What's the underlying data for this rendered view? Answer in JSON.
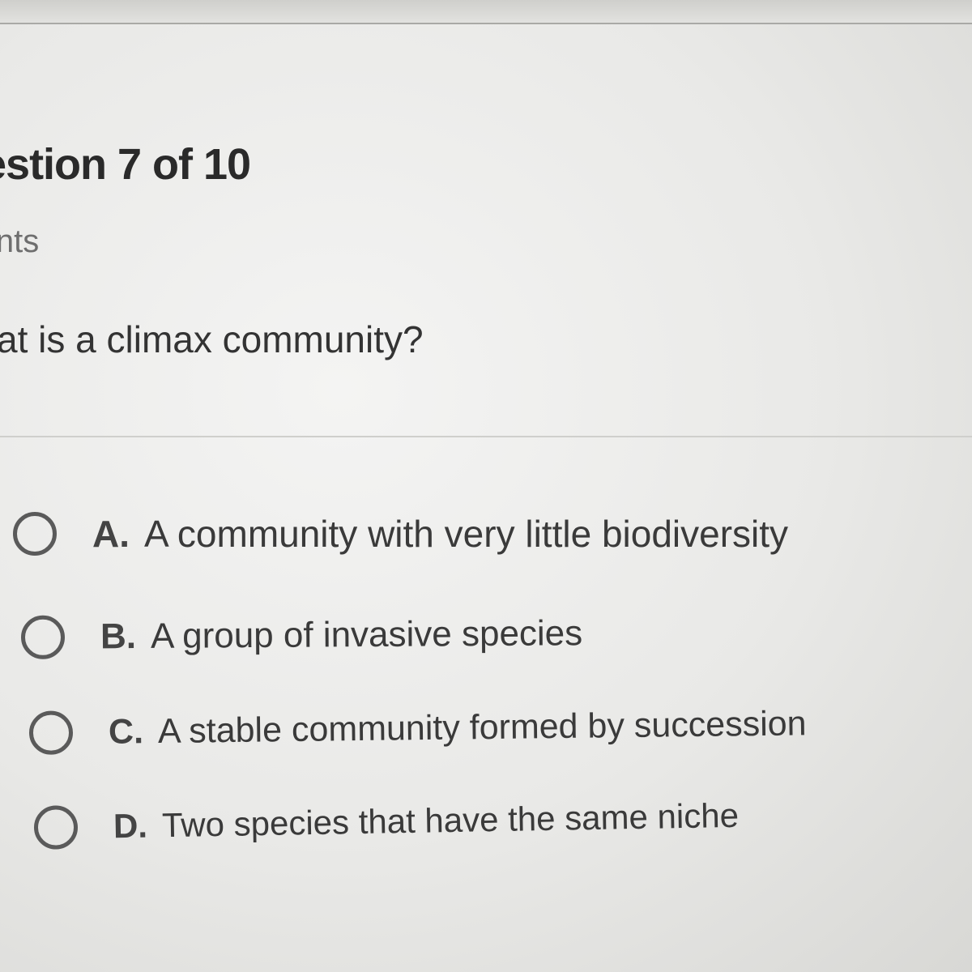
{
  "question": {
    "number_text": "estion 7 of 10",
    "points_text": "ints",
    "prompt": "at is a climax community?"
  },
  "answers": [
    {
      "letter": "A.",
      "text": "A community with very little biodiversity"
    },
    {
      "letter": "B.",
      "text": "A group of invasive species"
    },
    {
      "letter": "C.",
      "text": "A stable community formed by succession"
    },
    {
      "letter": "D.",
      "text": "Two species that have the same niche"
    }
  ],
  "colors": {
    "background": "#ececea",
    "heading": "#2a2a2a",
    "muted": "#6e6e6e",
    "radio_border": "#5a5a5a"
  }
}
